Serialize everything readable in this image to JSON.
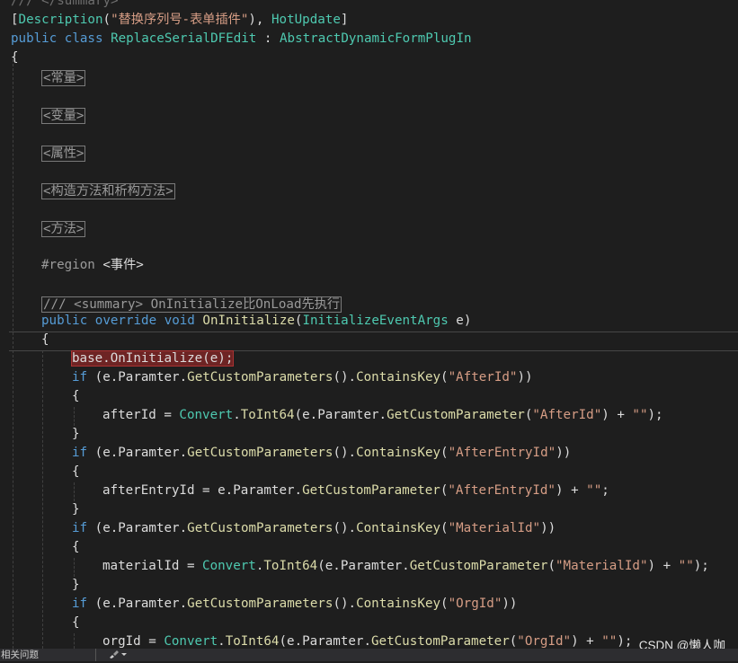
{
  "editor": {
    "summary_close": "/// </summary>",
    "attr_description": "Description",
    "attr_text": "\"替换序列号-表单插件\"",
    "attr_hotupdate": "HotUpdate",
    "kw_public": "public",
    "kw_class": "class",
    "class_name": "ReplaceSerialDFEdit",
    "base_class": "AbstractDynamicFormPlugIn",
    "region_constants": "<常量>",
    "region_variables": "<变量>",
    "region_properties": "<属性>",
    "region_ctors": "<构造方法和析构方法>",
    "region_methods": "<方法>",
    "region_directive": "#region",
    "region_events": "<事件>",
    "comment_oninit": "/// <summary> OnInitialize比OnLoad先执行",
    "kw_override": "override",
    "kw_void": "void",
    "method_oninit": "OnInitialize",
    "param_type": "InitializeEventArgs",
    "param_name": "e",
    "base_call": "base.OnInitialize(e);",
    "kw_if": "if",
    "e_paramter": "e.Paramter.",
    "get_custom_params": "GetCustomParameters",
    "contains_key": "ContainsKey",
    "key_afterid": "\"AfterId\"",
    "key_afterentryid": "\"AfterEntryId\"",
    "key_materialid": "\"MaterialId\"",
    "key_orgid": "\"OrgId\"",
    "var_afterid": "afterId",
    "var_afterentryid": "afterEntryId",
    "var_materialid": "materialId",
    "var_orgid": "orgId",
    "convert": "Convert",
    "to_int64": "ToInt64",
    "get_custom_param": "GetCustomParameter",
    "empty_str": "\"\""
  },
  "statusbar": {
    "left_text": "相关问题",
    "tools_icon": "brush-icon"
  },
  "watermark": "CSDN @懒人咖",
  "colors": {
    "background": "#1e1e1e",
    "keyword": "#569cd6",
    "type": "#4ec9b0",
    "method": "#dcdcaa",
    "string": "#d69d85",
    "comment": "#57a64a"
  }
}
